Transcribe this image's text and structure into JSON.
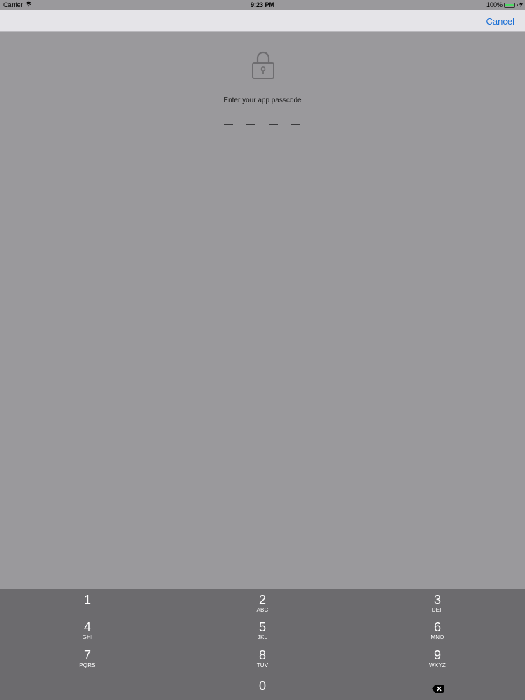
{
  "status_bar": {
    "carrier": "Carrier",
    "time": "9:23 PM",
    "battery": "100%",
    "battery_level": 1.0,
    "battery_color": "#4cd964"
  },
  "nav": {
    "cancel_label": "Cancel",
    "accent_color": "#1a6fd6"
  },
  "passcode": {
    "icon": "lock-icon",
    "prompt": "Enter your app passcode",
    "length": 4,
    "entered": 0
  },
  "keypad": {
    "keys": [
      {
        "digit": "1",
        "letters": ""
      },
      {
        "digit": "2",
        "letters": "ABC"
      },
      {
        "digit": "3",
        "letters": "DEF"
      },
      {
        "digit": "4",
        "letters": "GHI"
      },
      {
        "digit": "5",
        "letters": "JKL"
      },
      {
        "digit": "6",
        "letters": "MNO"
      },
      {
        "digit": "7",
        "letters": "PQRS"
      },
      {
        "digit": "8",
        "letters": "TUV"
      },
      {
        "digit": "9",
        "letters": "WXYZ"
      },
      {
        "digit": "0",
        "letters": ""
      }
    ],
    "delete_icon": "delete-backspace-icon"
  }
}
